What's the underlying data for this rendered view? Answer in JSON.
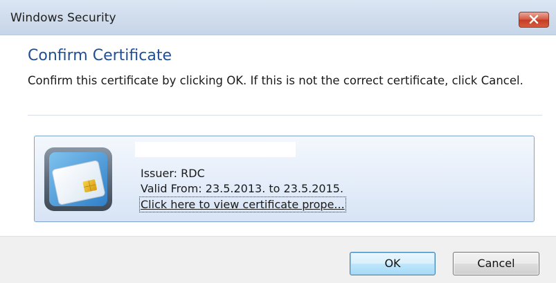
{
  "window": {
    "title": "Windows Security",
    "close_icon": "close-icon"
  },
  "dialog": {
    "heading": "Confirm Certificate",
    "description": "Confirm this certificate by clicking OK. If this is not the correct certificate, click Cancel."
  },
  "certificate": {
    "icon": "smart-card-icon",
    "issuer": "Issuer: RDC",
    "valid": "Valid From: 23.5.2013. to 23.5.2015.",
    "properties_link": "Click here to view certificate prope..."
  },
  "buttons": {
    "ok": "OK",
    "cancel": "Cancel"
  },
  "colors": {
    "heading": "#1f4e99",
    "close_button": "#d4553f",
    "card_border": "#7da2ce"
  }
}
